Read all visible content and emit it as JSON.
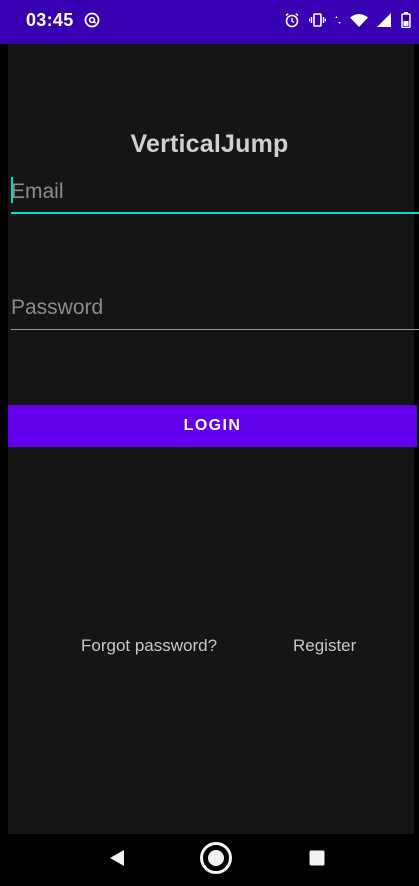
{
  "status_bar": {
    "time": "03:45",
    "left_icon": "at-sign-notification-icon",
    "right_icons": [
      "alarm-icon",
      "vibrate-icon",
      "data-arrows-icon",
      "wifi-icon",
      "cell-signal-icon",
      "battery-icon"
    ],
    "background": "#3700b3"
  },
  "app": {
    "title": "VerticalJump",
    "background": "#151515"
  },
  "email_field": {
    "placeholder": "Email",
    "value": "",
    "focused": true
  },
  "password_field": {
    "placeholder": "Password",
    "value": ""
  },
  "login_button": {
    "label": "LOGIN",
    "color": "#6200ee"
  },
  "links": {
    "forgot_password": "Forgot password?",
    "register": "Register"
  },
  "nav_bar": {
    "buttons": [
      "back-icon",
      "home-icon",
      "recents-icon"
    ]
  },
  "colors": {
    "accent": "#03dac5",
    "primary": "#6200ee",
    "primary_dark": "#3700b3"
  }
}
